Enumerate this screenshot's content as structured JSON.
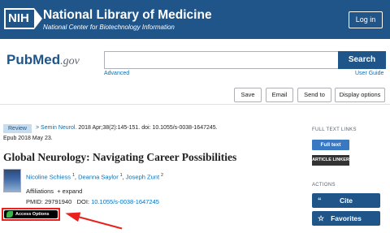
{
  "header": {
    "logo_text": "NIH",
    "title": "National Library of Medicine",
    "subtitle": "National Center for Biotechnology Information",
    "login_label": "Log in"
  },
  "search": {
    "logo_main_a": "Pub",
    "logo_main_b": "Med",
    "logo_suffix": ".gov",
    "value": "",
    "button_label": "Search",
    "advanced_label": "Advanced",
    "guide_label": "User Guide"
  },
  "toolbar": {
    "save_label": "Save",
    "email_label": "Email",
    "sendto_label": "Send to",
    "display_label": "Display options"
  },
  "article": {
    "type_badge": "Review",
    "journal": "Semin Neurol.",
    "citation_rest": "2018 Apr;38(2):145-151. doi: 10.1055/s-0038-1647245.",
    "epub": "Epub 2018 May 23.",
    "title": "Global Neurology: Navigating Career Possibilities",
    "authors": [
      {
        "name": "Nicoline Schiess",
        "sup": "1"
      },
      {
        "name": "Deanna Saylor",
        "sup": "1"
      },
      {
        "name": "Joseph Zunt",
        "sup": "2"
      }
    ],
    "affiliations_label": "Affiliations",
    "expand_label": "+ expand",
    "pmid_label": "PMID:",
    "pmid": "29791940",
    "doi_label": "DOI:",
    "doi": "10.1055/s-0038-1647245",
    "access_label": "Access Options"
  },
  "sidebar": {
    "fulltext_heading": "FULL TEXT LINKS",
    "fulltext_badge": "Full text",
    "linker_badge": "ARTICLE LINKER",
    "actions_heading": "ACTIONS",
    "cite_label": "Cite",
    "favorites_label": "Favorites"
  },
  "colors": {
    "brand_blue": "#20558a",
    "link_blue": "#0071bc",
    "annotation_red": "#e8211c"
  }
}
